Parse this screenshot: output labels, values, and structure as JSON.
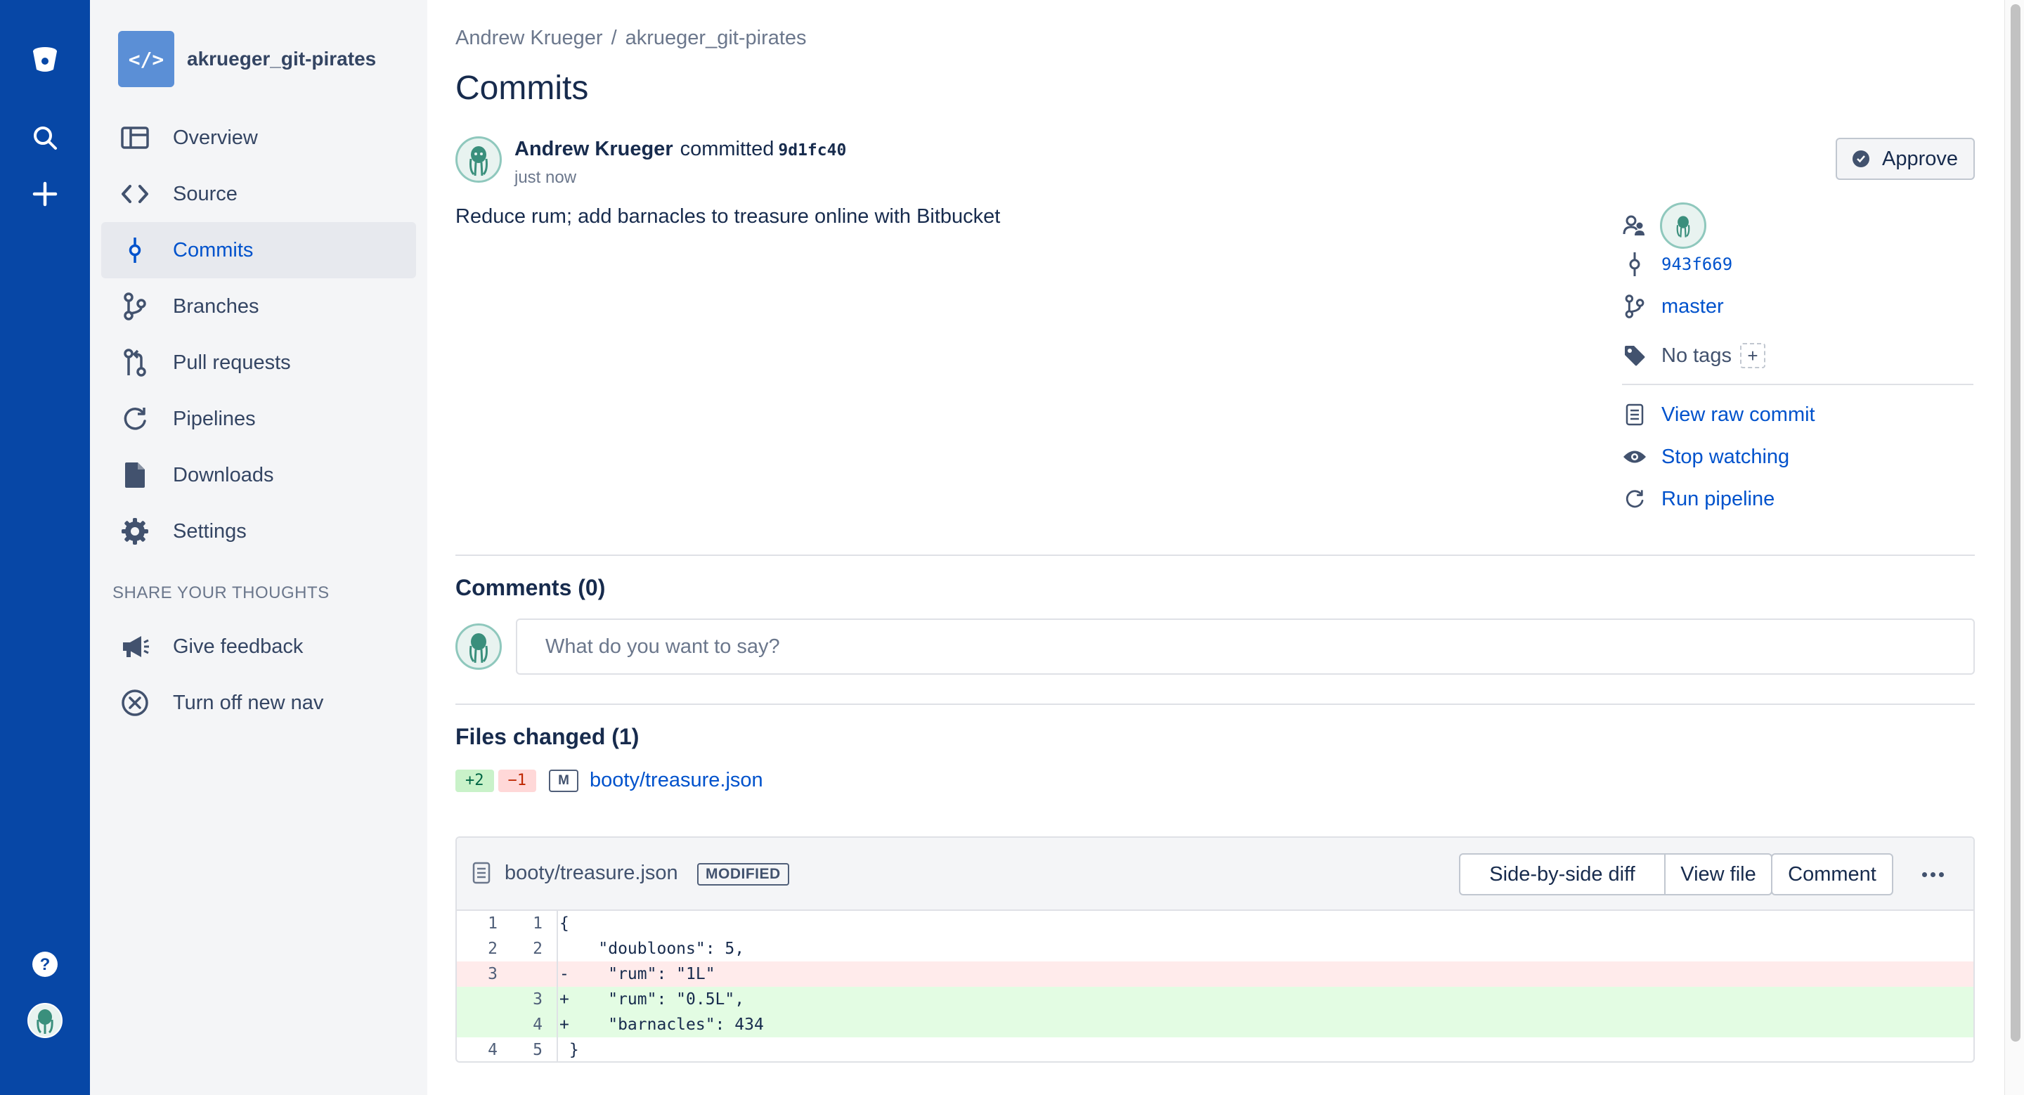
{
  "global_nav": {
    "items": [
      "bitbucket-logo",
      "search",
      "create",
      "help",
      "profile"
    ]
  },
  "sidebar": {
    "repo_icon": "</>",
    "repo_name": "akrueger_git-pirates",
    "items": [
      {
        "label": "Overview",
        "icon": "overview-icon"
      },
      {
        "label": "Source",
        "icon": "code-icon"
      },
      {
        "label": "Commits",
        "icon": "commit-icon",
        "active": true
      },
      {
        "label": "Branches",
        "icon": "branch-icon"
      },
      {
        "label": "Pull requests",
        "icon": "pull-request-icon"
      },
      {
        "label": "Pipelines",
        "icon": "pipelines-icon"
      },
      {
        "label": "Downloads",
        "icon": "document-icon"
      },
      {
        "label": "Settings",
        "icon": "gear-icon"
      }
    ],
    "section_title": "SHARE YOUR THOUGHTS",
    "feedback_items": [
      {
        "label": "Give feedback",
        "icon": "megaphone-icon"
      },
      {
        "label": "Turn off new nav",
        "icon": "close-circle-icon"
      }
    ]
  },
  "breadcrumb": {
    "owner": "Andrew Krueger",
    "separator": "/",
    "repo": "akrueger_git-pirates"
  },
  "page_title": "Commits",
  "commit": {
    "author": "Andrew Krueger",
    "verb": "committed",
    "hash": "9d1fc40",
    "when": "just now",
    "message": "Reduce rum; add barnacles to treasure online with Bitbucket",
    "approve_label": "Approve",
    "parent_hash": "943f669",
    "branch": "master",
    "tags_label": "No tags",
    "add_tag": "+",
    "actions": {
      "view_raw": "View raw commit",
      "watch": "Stop watching",
      "run_pipeline": "Run pipeline"
    }
  },
  "comments": {
    "heading": "Comments (0)",
    "placeholder": "What do you want to say?"
  },
  "files_changed": {
    "heading": "Files changed (1)",
    "files": [
      {
        "added": "+2",
        "removed": "−1",
        "status": "M",
        "path": "booty/treasure.json"
      }
    ]
  },
  "diff": {
    "filename": "booty/treasure.json",
    "status_badge": "MODIFIED",
    "buttons": {
      "side_by_side": "Side-by-side diff",
      "view_file": "View file",
      "comment": "Comment"
    },
    "lines": [
      {
        "old": "1",
        "new": "1",
        "type": "context",
        "text": "{"
      },
      {
        "old": "2",
        "new": "2",
        "type": "context",
        "text": "    \"doubloons\": 5,"
      },
      {
        "old": "3",
        "new": "",
        "type": "removed",
        "text": "-    \"rum\": \"1L\""
      },
      {
        "old": "",
        "new": "3",
        "type": "added",
        "text": "+    \"rum\": \"0.5L\","
      },
      {
        "old": "",
        "new": "4",
        "type": "added",
        "text": "+    \"barnacles\": 434"
      },
      {
        "old": "4",
        "new": "5",
        "type": "context",
        "text": " }"
      }
    ]
  },
  "colors": {
    "rail": "#0747a6",
    "link": "#0052cc",
    "added_bg": "#e3fce3",
    "removed_bg": "#ffebeb"
  }
}
